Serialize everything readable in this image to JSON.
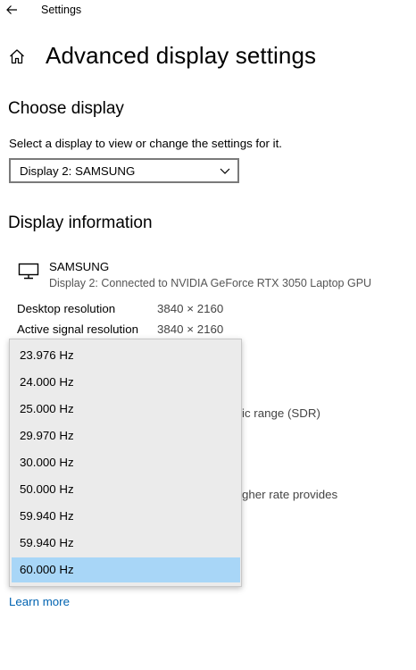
{
  "window": {
    "title": "Settings"
  },
  "page": {
    "title": "Advanced display settings"
  },
  "choose_display": {
    "heading": "Choose display",
    "description": "Select a display to view or change the settings for it.",
    "selected": "Display 2: SAMSUNG"
  },
  "display_info": {
    "heading": "Display information",
    "monitor_name": "SAMSUNG",
    "monitor_desc": "Display 2: Connected to NVIDIA GeForce RTX 3050 Laptop GPU",
    "rows": [
      {
        "label": "Desktop resolution",
        "value": "3840 × 2160"
      },
      {
        "label": "Active signal resolution",
        "value": "3840 × 2160"
      }
    ],
    "partial_text_1": "ic range (SDR)",
    "partial_text_2": "gher rate provides"
  },
  "refresh_dropdown": {
    "options": [
      "23.976 Hz",
      "24.000 Hz",
      "25.000 Hz",
      "29.970 Hz",
      "30.000 Hz",
      "50.000 Hz",
      "59.940 Hz",
      "59.940 Hz",
      "60.000 Hz"
    ],
    "selected_index": 8
  },
  "links": {
    "learn_more": "Learn more"
  },
  "colors": {
    "accent": "#0063b1",
    "selection": "#a8d6f7"
  }
}
